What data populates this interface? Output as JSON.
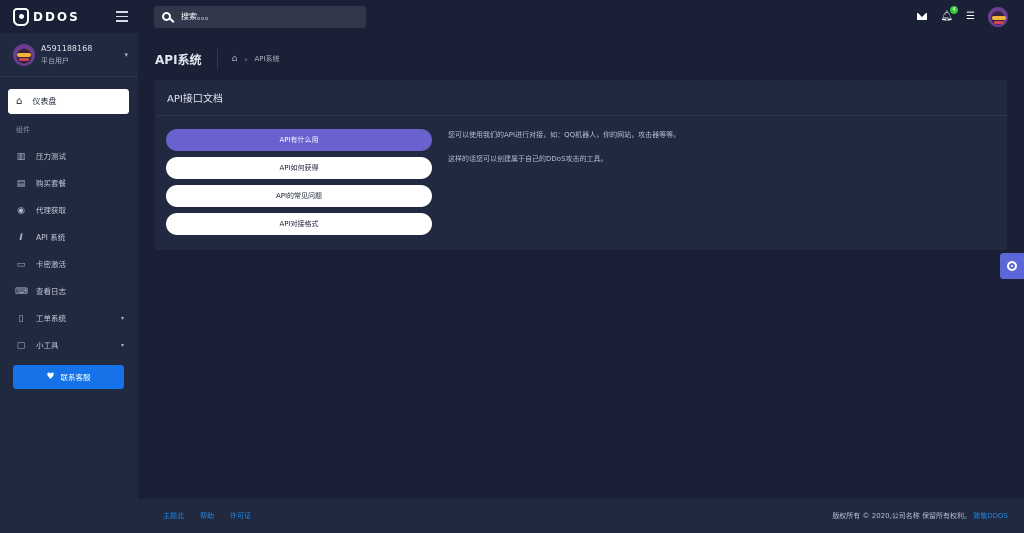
{
  "brand": {
    "name": "DDOS"
  },
  "user": {
    "name": "A591188168",
    "role": "平台用户"
  },
  "search": {
    "placeholder": "搜索。。。"
  },
  "notifications": {
    "count": "4"
  },
  "sidebar": {
    "active_item": "仪表盘",
    "section_title": "组件",
    "items": [
      {
        "label": "压力测试"
      },
      {
        "label": "购买套餐"
      },
      {
        "label": "代理获取"
      },
      {
        "label": "API 系统"
      },
      {
        "label": "卡密激活"
      },
      {
        "label": "查看日志"
      },
      {
        "label": "工单系统"
      },
      {
        "label": "小工具"
      }
    ],
    "contact_button": "联系客服"
  },
  "page": {
    "title": "API系统",
    "breadcrumb": "API系统"
  },
  "card": {
    "title": "API接口文档",
    "tabs": [
      {
        "label": "API有什么用"
      },
      {
        "label": "API如何获得"
      },
      {
        "label": "API的常见问题"
      },
      {
        "label": "API对接格式"
      }
    ],
    "content": [
      "您可以使用我们的API进行对接，如：QQ机器人，你的网站，攻击器等等。",
      "这样的话您可以创建属于自己的DDoS攻击的工具。"
    ]
  },
  "footer": {
    "links": [
      "主题北",
      "帮助",
      "许可证"
    ],
    "copyright": "版权所有 © 2020,公司名称 保留所有权利。",
    "copyright_link": "致敬DDOS"
  },
  "colors": {
    "accent": "#6861ce",
    "primary": "#1572e8",
    "sidebar_bg": "#202940",
    "page_bg": "#1a2035"
  }
}
